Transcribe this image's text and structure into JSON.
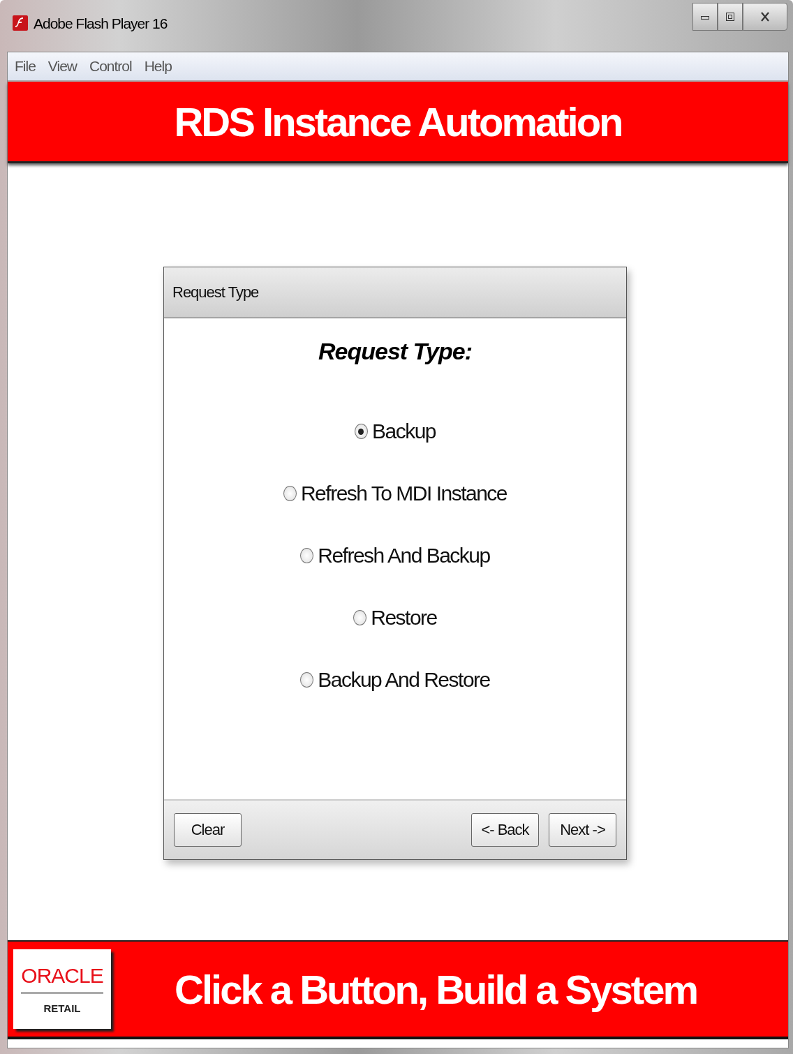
{
  "window": {
    "title": "Adobe Flash Player 16"
  },
  "menu": [
    "File",
    "View",
    "Control",
    "Help"
  ],
  "header": {
    "title": "RDS Instance Automation"
  },
  "panel": {
    "title": "Request Type",
    "heading": "Request Type:",
    "options": [
      {
        "label": "Backup",
        "selected": true
      },
      {
        "label": "Refresh To MDI Instance",
        "selected": false
      },
      {
        "label": "Refresh And Backup",
        "selected": false
      },
      {
        "label": "Restore",
        "selected": false
      },
      {
        "label": "Backup And Restore",
        "selected": false
      }
    ],
    "buttons_left": [
      "Clear"
    ],
    "buttons_right": [
      "<- Back",
      "Next ->"
    ]
  },
  "footer": {
    "logo_name": "ORACLE",
    "logo_sub": "RETAIL",
    "slogan": "Click a Button, Build a System"
  }
}
